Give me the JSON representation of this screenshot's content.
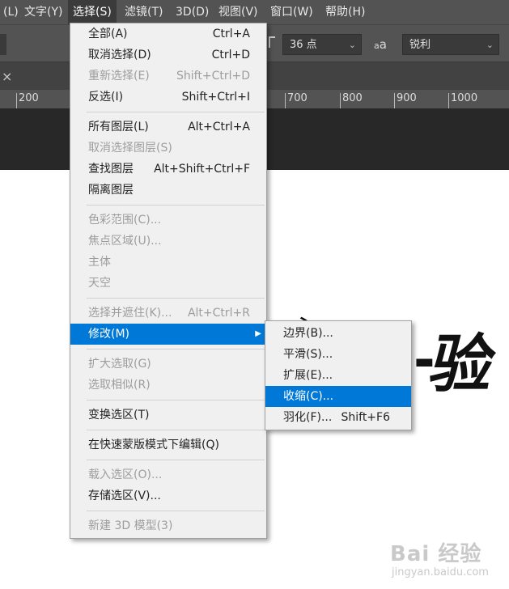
{
  "menubar": {
    "items": [
      {
        "label": "(L)"
      },
      {
        "label": "文字(Y)"
      },
      {
        "label": "选择(S)"
      },
      {
        "label": "滤镜(T)"
      },
      {
        "label": "3D(D)"
      },
      {
        "label": "视图(V)"
      },
      {
        "label": "窗口(W)"
      },
      {
        "label": "帮助(H)"
      }
    ]
  },
  "options": {
    "font_size": "36 点",
    "aa_icon": "aa-icon",
    "antialias": "锐利",
    "dropdown_icon": "chevron-down-icon"
  },
  "tab": {
    "close_icon": "close-icon",
    "close_glyph": "×"
  },
  "ruler": {
    "ticks": [
      "200",
      "700",
      "800",
      "900",
      "1000"
    ]
  },
  "select_menu": {
    "items": [
      {
        "label": "全部(A)",
        "shortcut": "Ctrl+A"
      },
      {
        "label": "取消选择(D)",
        "shortcut": "Ctrl+D"
      },
      {
        "label": "重新选择(E)",
        "shortcut": "Shift+Ctrl+D"
      },
      {
        "label": "反选(I)",
        "shortcut": "Shift+Ctrl+I"
      },
      {
        "label": "所有图层(L)",
        "shortcut": "Alt+Ctrl+A"
      },
      {
        "label": "取消选择图层(S)",
        "shortcut": ""
      },
      {
        "label": "查找图层",
        "shortcut": "Alt+Shift+Ctrl+F"
      },
      {
        "label": "隔离图层",
        "shortcut": ""
      },
      {
        "label": "色彩范围(C)...",
        "shortcut": ""
      },
      {
        "label": "焦点区域(U)...",
        "shortcut": ""
      },
      {
        "label": "主体",
        "shortcut": ""
      },
      {
        "label": "天空",
        "shortcut": ""
      },
      {
        "label": "选择并遮住(K)...",
        "shortcut": "Alt+Ctrl+R"
      },
      {
        "label": "修改(M)",
        "shortcut": ""
      },
      {
        "label": "扩大选取(G)",
        "shortcut": ""
      },
      {
        "label": "选取相似(R)",
        "shortcut": ""
      },
      {
        "label": "变换选区(T)",
        "shortcut": ""
      },
      {
        "label": "在快速蒙版模式下编辑(Q)",
        "shortcut": ""
      },
      {
        "label": "载入选区(O)...",
        "shortcut": ""
      },
      {
        "label": "存储选区(V)...",
        "shortcut": ""
      },
      {
        "label": "新建 3D 模型(3)",
        "shortcut": ""
      }
    ],
    "submenu_arrow_icon": "chevron-right-icon"
  },
  "modify_submenu": {
    "items": [
      {
        "label": "边界(B)...",
        "shortcut": ""
      },
      {
        "label": "平滑(S)...",
        "shortcut": ""
      },
      {
        "label": "扩展(E)...",
        "shortcut": ""
      },
      {
        "label": "收缩(C)...",
        "shortcut": ""
      },
      {
        "label": "羽化(F)...",
        "shortcut": "Shift+F6"
      }
    ]
  },
  "canvas": {
    "glyph_text": "验"
  },
  "watermark": {
    "main": "Bai 经验",
    "url": "jingyan.baidu.com"
  },
  "colors": {
    "menubar_bg": "#535353",
    "menu_bg": "#f0f0f0",
    "highlight": "#0078d7",
    "disabled_text": "#9d9d9d"
  }
}
